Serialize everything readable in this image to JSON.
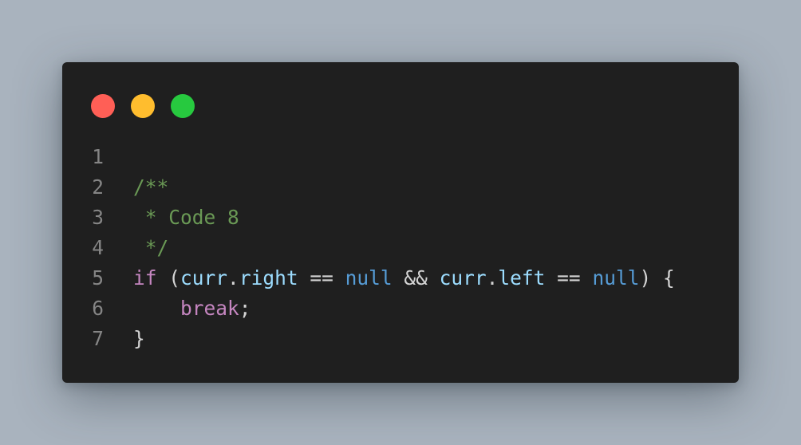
{
  "window": {
    "traffic_lights": [
      {
        "name": "close",
        "color": "#ff5f56"
      },
      {
        "name": "minimize",
        "color": "#ffbd2e"
      },
      {
        "name": "maximize",
        "color": "#27c93f"
      }
    ]
  },
  "editor": {
    "lines": [
      {
        "number": "1",
        "tokens": []
      },
      {
        "number": "2",
        "tokens": [
          {
            "text": "/**",
            "kind": "comment"
          }
        ]
      },
      {
        "number": "3",
        "tokens": [
          {
            "text": " * Code 8",
            "kind": "comment"
          }
        ]
      },
      {
        "number": "4",
        "tokens": [
          {
            "text": " */",
            "kind": "comment"
          }
        ]
      },
      {
        "number": "5",
        "tokens": [
          {
            "text": "if",
            "kind": "keyword"
          },
          {
            "text": " (",
            "kind": "punct"
          },
          {
            "text": "curr",
            "kind": "var"
          },
          {
            "text": ".",
            "kind": "punct"
          },
          {
            "text": "right",
            "kind": "var"
          },
          {
            "text": " == ",
            "kind": "punct"
          },
          {
            "text": "null",
            "kind": "const"
          },
          {
            "text": " && ",
            "kind": "punct"
          },
          {
            "text": "curr",
            "kind": "var"
          },
          {
            "text": ".",
            "kind": "punct"
          },
          {
            "text": "left",
            "kind": "var"
          },
          {
            "text": " == ",
            "kind": "punct"
          },
          {
            "text": "null",
            "kind": "const"
          },
          {
            "text": ") {",
            "kind": "punct"
          }
        ]
      },
      {
        "number": "6",
        "tokens": [
          {
            "text": "    ",
            "kind": "punct"
          },
          {
            "text": "break",
            "kind": "keyword"
          },
          {
            "text": ";",
            "kind": "punct"
          }
        ]
      },
      {
        "number": "7",
        "tokens": [
          {
            "text": "}",
            "kind": "punct"
          }
        ]
      }
    ]
  }
}
